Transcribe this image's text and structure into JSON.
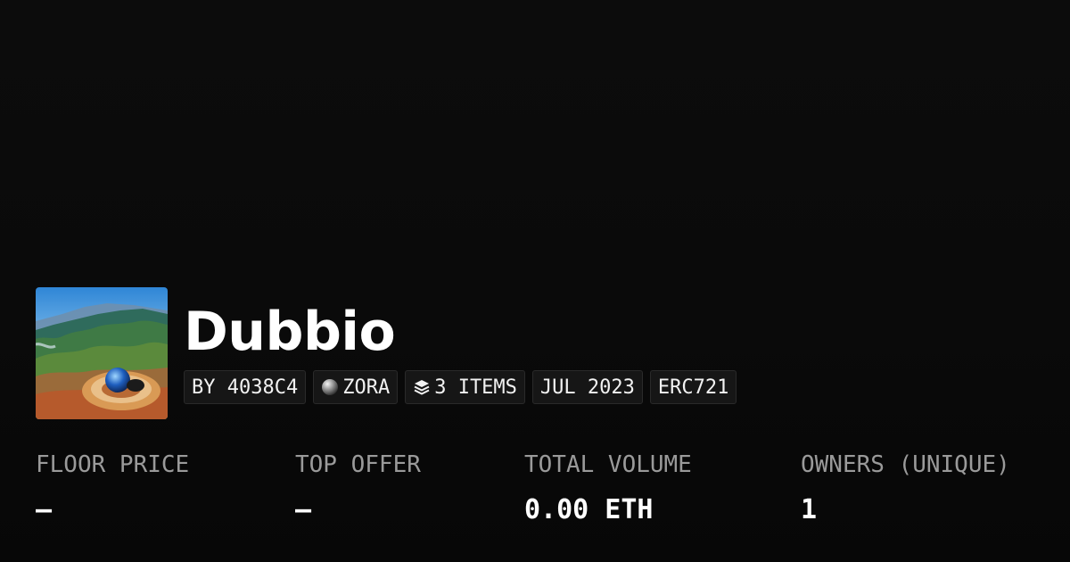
{
  "collection": {
    "title": "Dubbio",
    "thumbnail_icon": "landscape-thumbnail"
  },
  "chips": [
    {
      "label": "BY 4038C4",
      "icon": null
    },
    {
      "label": "ZORA",
      "icon": "zora-orb-icon"
    },
    {
      "label": "3 ITEMS",
      "icon": "layers-icon"
    },
    {
      "label": "JUL 2023",
      "icon": null
    },
    {
      "label": "ERC721",
      "icon": null
    }
  ],
  "stats": [
    {
      "label": "FLOOR PRICE",
      "value": "–"
    },
    {
      "label": "TOP OFFER",
      "value": "–"
    },
    {
      "label": "TOTAL VOLUME",
      "value": "0.00 ETH"
    },
    {
      "label": "OWNERS (UNIQUE)",
      "value": "1"
    }
  ],
  "colors": {
    "background": "#0a0a0a",
    "chip_background": "#161616",
    "label": "#9a9a9a",
    "text": "#ffffff"
  }
}
